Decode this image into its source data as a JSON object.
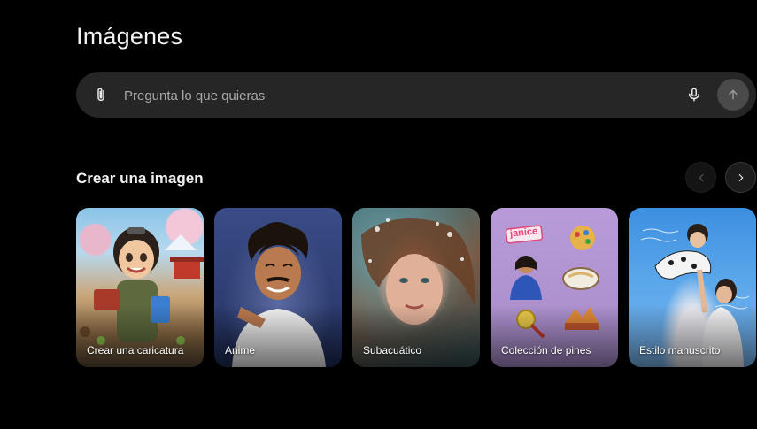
{
  "page": {
    "title": "Imágenes"
  },
  "composer": {
    "placeholder": "Pregunta lo que quieras",
    "attach_icon": "paperclip-icon",
    "mic_icon": "microphone-icon",
    "send_icon": "arrow-up-icon"
  },
  "section": {
    "title": "Crear una imagen",
    "prev_icon": "chevron-left-icon",
    "next_icon": "chevron-right-icon"
  },
  "cards": [
    {
      "label": "Crear una caricatura"
    },
    {
      "label": "Anime"
    },
    {
      "label": "Subacuático"
    },
    {
      "label": "Colección de pines",
      "pin_text": "janice"
    },
    {
      "label": "Estilo manuscrito"
    }
  ],
  "colors": {
    "background": "#000000",
    "composer_bg": "#262626",
    "send_button_bg": "#4a4a4a",
    "text_primary": "#f2f2f2",
    "placeholder": "#a8a8a8"
  }
}
